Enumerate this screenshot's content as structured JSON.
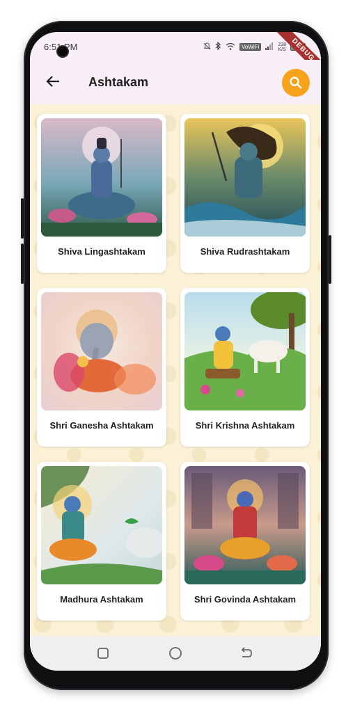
{
  "status_bar": {
    "time": "6:51 PM",
    "net_speed_value": "238",
    "net_speed_unit": "K/S",
    "volte_label": "VoWiFi",
    "debug_banner": "DEBUG"
  },
  "app_bar": {
    "title": "Ashtakam",
    "back_icon": "arrow-left-icon",
    "search_icon": "search-icon"
  },
  "colors": {
    "accent": "#f6a21a",
    "app_bar_bg": "#f7eef6",
    "content_bg": "#fbf1d6",
    "debug_ribbon": "#a8302f"
  },
  "cards": [
    {
      "label": "Shiva Lingashtakam"
    },
    {
      "label": "Shiva Rudrashtakam"
    },
    {
      "label": "Shri Ganesha Ashtakam"
    },
    {
      "label": "Shri Krishna Ashtakam"
    },
    {
      "label": "Madhura Ashtakam"
    },
    {
      "label": "Shri Govinda Ashtakam"
    }
  ],
  "nav_bar": {
    "recents_icon": "square-icon",
    "home_icon": "circle-icon",
    "back_icon": "back-arrow-icon"
  }
}
